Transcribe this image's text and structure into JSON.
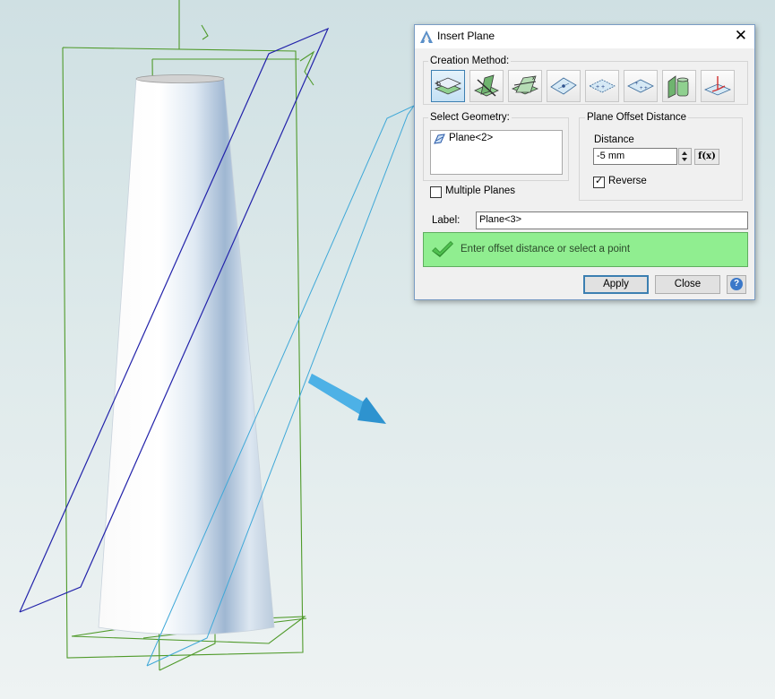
{
  "dialog": {
    "title": "Insert Plane",
    "creation_method": {
      "legend": "Creation Method:",
      "methods": [
        "offset-plane-icon",
        "plane-at-angle-icon",
        "plane-through-edges-icon",
        "plane-through-point-icon",
        "plane-through-three-points-icon",
        "plane-through-two-points-icon",
        "tangent-plane-icon",
        "plane-from-coordinate-system-icon"
      ]
    },
    "select_geometry": {
      "legend": "Select Geometry:",
      "items": [
        "Plane<2>"
      ]
    },
    "multiple_planes": {
      "label": "Multiple Planes",
      "checked": false
    },
    "offset": {
      "legend": "Plane Offset Distance",
      "distance_label": "Distance",
      "distance_value": "-5 mm",
      "fx_label": "f(x)",
      "reverse_label": "Reverse",
      "reverse_checked": true
    },
    "label_field": {
      "label": "Label:",
      "value": "Plane<3>"
    },
    "status_message": "Enter offset distance or select a point",
    "buttons": {
      "apply": "Apply",
      "close": "Close"
    }
  },
  "colors": {
    "status_bg": "#90ee90",
    "accent": "#3c7fb1",
    "plane_selected": "#2222aa",
    "plane_preview": "#3fa8d8",
    "bounding_lines": "#4f9a2a"
  }
}
